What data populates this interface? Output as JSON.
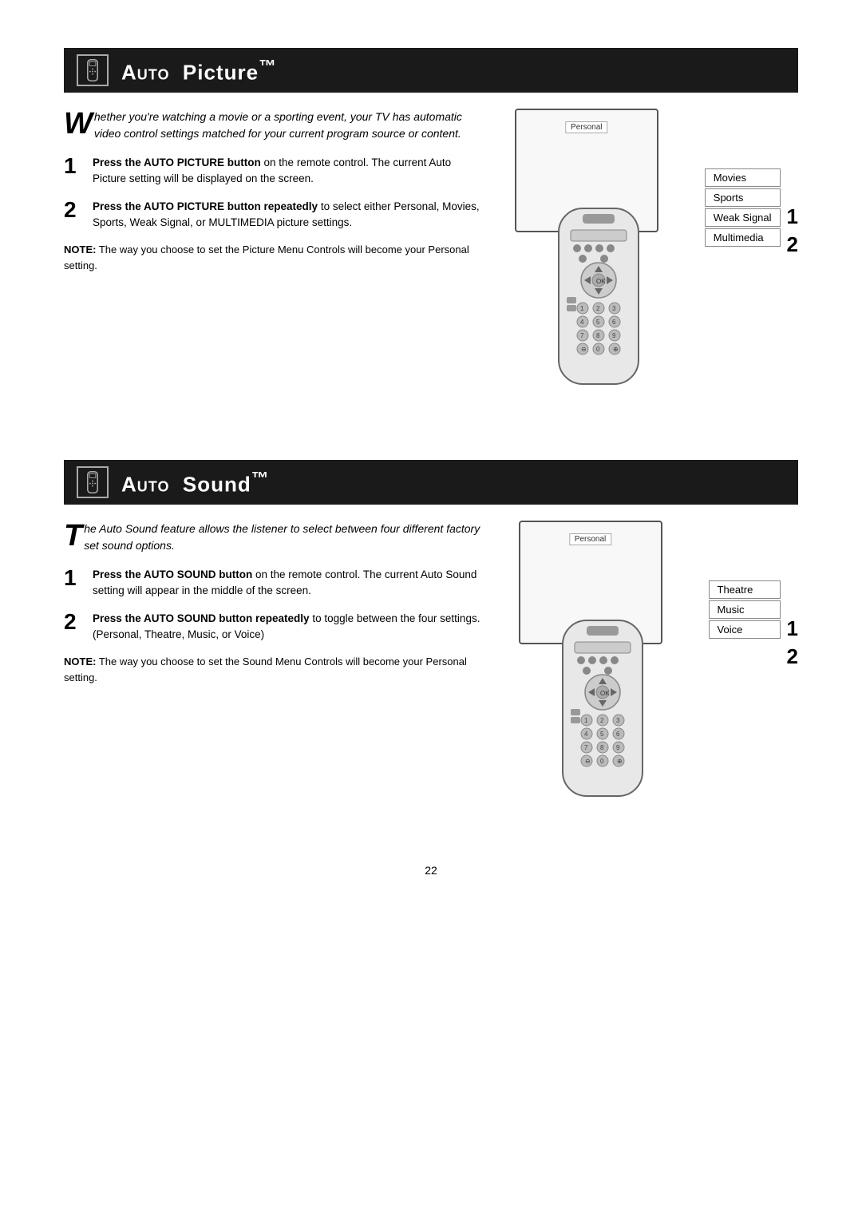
{
  "auto_picture": {
    "title_prefix": "Auto",
    "title_main": "Picture",
    "title_tm": "™",
    "intro_drop": "W",
    "intro_text": "hether you're watching a movie or a sporting event, your TV has automatic video control settings matched for your current program source or content.",
    "step1_label": "1",
    "step1_bold": "Press the AUTO PICTURE button",
    "step1_rest": " on the remote control. The current Auto Picture setting will be displayed on the screen.",
    "step2_label": "2",
    "step2_bold": "Press the AUTO PICTURE button repeatedly",
    "step2_rest": " to select either Personal, Movies, Sports, Weak Signal, or MULTIMEDIA  picture settings.",
    "note_bold": "NOTE:",
    "note_text": " The way you choose to set the Picture Menu Controls will become your Personal setting.",
    "tv_label": "Personal",
    "menu_items": [
      "Movies",
      "Sports",
      "Weak Signal",
      "Multimedia"
    ],
    "step_indicators": [
      "1",
      "2"
    ]
  },
  "auto_sound": {
    "title_prefix": "Auto",
    "title_main": "Sound",
    "title_tm": "™",
    "intro_drop": "T",
    "intro_text": "he Auto Sound feature allows the listener to select between four different factory set sound options.",
    "step1_label": "1",
    "step1_bold": "Press the AUTO SOUND button",
    "step1_rest": " on the remote control. The current Auto Sound setting will appear in the middle of the screen.",
    "step2_label": "2",
    "step2_bold": "Press the AUTO  SOUND button repeatedly",
    "step2_rest": " to toggle between the four settings. (Personal, Theatre, Music, or Voice)",
    "note_bold": "NOTE:",
    "note_text": " The way you choose to set the Sound Menu Controls will become your Personal setting.",
    "tv_label": "Personal",
    "menu_items": [
      "Theatre",
      "Music",
      "Voice"
    ],
    "step_indicators": [
      "1",
      "2"
    ]
  },
  "page_number": "22"
}
